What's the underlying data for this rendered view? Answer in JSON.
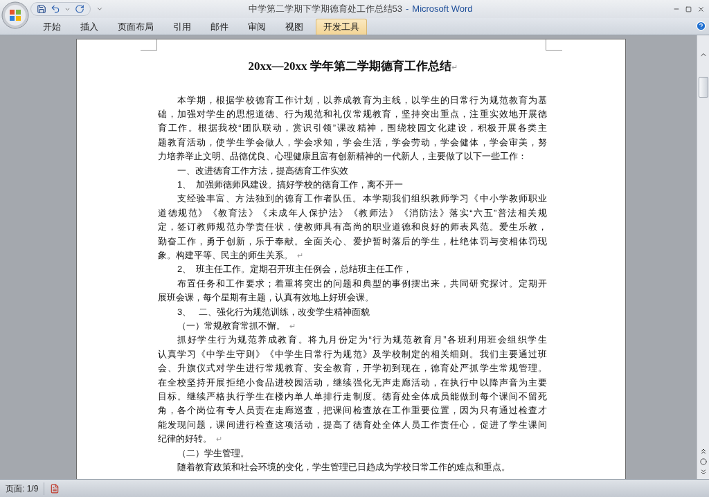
{
  "window": {
    "title": "中学第二学期下学期德育处工作总结53",
    "separator": "-",
    "app": "Microsoft Word"
  },
  "ribbon_tabs": [
    {
      "label": "开始",
      "selected": false
    },
    {
      "label": "插入",
      "selected": false
    },
    {
      "label": "页面布局",
      "selected": false
    },
    {
      "label": "引用",
      "selected": false
    },
    {
      "label": "邮件",
      "selected": false
    },
    {
      "label": "审阅",
      "selected": false
    },
    {
      "label": "视图",
      "selected": false
    },
    {
      "label": "开发工具",
      "selected": true
    }
  ],
  "document": {
    "title": "20xx—20xx 学年第二学期德育工作总结",
    "title_mark": "↵",
    "paragraphs": [
      {
        "lines": [
          "本学期，根据学校德育工作计划，以养成教育为主线，以学生的日常行为规范教育为基",
          "础，加强对学生的思想道德、行为规范和礼仪常规教育，坚持突出重点，注重实效地开展德",
          "育工作。根据我校“团队联动，赏识引领”课改精神，围绕校园文化建设，积极开展各类主",
          "题教育活动，使学生学会做人，学会求知，学会生活，学会劳动，学会健体，学会审美，努",
          "力培养举止文明、品德优良、心理健康且富有创新精神的一代新人，主要做了以下一些工作："
        ]
      },
      {
        "lines": [
          "一、改进德育工作方法，提高德育工作实效"
        ]
      },
      {
        "lines": [
          "1、  加强师德师风建设。搞好学校的德育工作，离不开一"
        ]
      },
      {
        "lines": [
          "支经验丰富、方法独到的德育工作者队伍。本学期我们组织教师学习《中小学教师职业",
          "道德规范》《教育法》《未成年人保护法》《教师法》《消防法》落实“六五”普法相关规",
          "定，签订教师规范办学责任状，使教师具有高尚的职业道德和良好的师表风范。爱生乐教，",
          "勤奋工作，勇于创新，乐于奉献。全面关心、爱护暂时落后的学生，杜绝体罚与变相体罚现",
          "象。构建平等、民主的师生关系。"
        ],
        "end_mark": "↵"
      },
      {
        "lines": [
          "2、  班主任工作。定期召开班主任例会，总结班主任工作，"
        ]
      },
      {
        "lines": [
          "布置任务和工作要求；着重将突出的问题和典型的事例摆出来，共同研究探讨。定期开",
          "展班会课，每个星期有主题，认真有效地上好班会课。"
        ]
      },
      {
        "lines": [
          "3、   二、强化行为规范训练，改变学生精神面貌"
        ]
      },
      {
        "lines": [
          "（一）常规教育常抓不懈。"
        ],
        "end_mark": "↵"
      },
      {
        "lines": [
          "抓好学生行为规范养成教育。将九月份定为“行为规范教育月”各班利用班会组织学生",
          "认真学习《中学生守则》《中学生日常行为规范》及学校制定的相关细则。我们主要通过班",
          "会、升旗仪式对学生进行常规教育、安全教育，开学初到现在，德育处严抓学生常规管理。",
          "在全校坚持开展拒绝小食品进校园活动，继续强化无声走廊活动，在执行中以降声音为主要",
          "目标。继续严格执行学生在楼内单人单排行走制度。德育处全体成员能做到每个课间不留死",
          "角，各个岗位有专人员责在走廊巡查，把课间检查放在工作重要位置，因为只有通过检查才",
          "能发现问题，课间进行检查这项活动，提高了德育处全体人员工作责任心，促进了学生课间",
          "纪律的好转。"
        ],
        "end_mark": "↵"
      },
      {
        "lines": [
          "（二）学生管理。"
        ]
      },
      {
        "lines": [
          "随着教育政策和社会环境的变化，学生管理已日趋成为学校日常工作的难点和重点。"
        ]
      }
    ]
  },
  "status_bar": {
    "page": "页面: 1/9"
  }
}
